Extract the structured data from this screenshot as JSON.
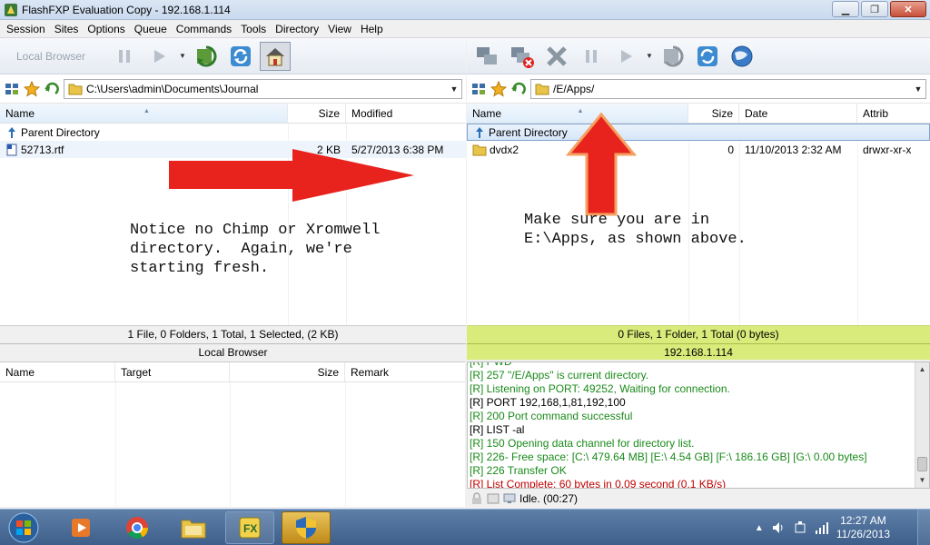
{
  "window": {
    "title": "FlashFXP Evaluation Copy - 192.168.1.114"
  },
  "menu": [
    "Session",
    "Sites",
    "Options",
    "Queue",
    "Commands",
    "Tools",
    "Directory",
    "View",
    "Help"
  ],
  "left_pane": {
    "toolbar_label": "Local Browser",
    "path": "C:\\Users\\admin\\Documents\\Journal",
    "columns": {
      "name": "Name",
      "size": "Size",
      "modified": "Modified"
    },
    "rows": [
      {
        "name": "Parent Directory",
        "size": "",
        "modified": ""
      },
      {
        "name": "52713.rtf",
        "size": "2 KB",
        "modified": "5/27/2013 6:38 PM"
      }
    ],
    "note": "Notice no Chimp or Xromwell\ndirectory.  Again, we're\nstarting fresh.",
    "status": "1 File, 0 Folders, 1 Total, 1 Selected, (2 KB)",
    "status_sub": "Local Browser"
  },
  "right_pane": {
    "path": "/E/Apps/",
    "columns": {
      "name": "Name",
      "size": "Size",
      "date": "Date",
      "attrib": "Attrib"
    },
    "rows": [
      {
        "name": "Parent Directory",
        "size": "",
        "date": "",
        "attrib": ""
      },
      {
        "name": "dvdx2",
        "size": "0",
        "date": "11/10/2013 2:32 AM",
        "attrib": "drwxr-xr-x"
      }
    ],
    "note": "Make sure you are in\nE:\\Apps, as shown above.",
    "status": "0 Files, 1 Folder, 1 Total (0 bytes)",
    "status_sub": "192.168.1.114"
  },
  "queue": {
    "columns": {
      "name": "Name",
      "target": "Target",
      "size": "Size",
      "remark": "Remark"
    }
  },
  "log": {
    "lines": [
      {
        "text": "[R] PWD",
        "color": "green"
      },
      {
        "text": "[R] 257 \"/E/Apps\" is current directory.",
        "color": "green"
      },
      {
        "text": "[R] Listening on PORT: 49252, Waiting for connection.",
        "color": "green"
      },
      {
        "text": "[R] PORT 192,168,1,81,192,100",
        "color": "black"
      },
      {
        "text": "[R] 200 Port command successful",
        "color": "green"
      },
      {
        "text": "[R] LIST -al",
        "color": "black"
      },
      {
        "text": "[R] 150 Opening data channel for directory list.",
        "color": "green"
      },
      {
        "text": "[R] 226- Free space: [C:\\ 479.64 MB] [E:\\ 4.54 GB] [F:\\ 186.16 GB] [G:\\ 0.00 bytes]",
        "color": "green"
      },
      {
        "text": "[R] 226 Transfer OK",
        "color": "green"
      },
      {
        "text": "[R] List Complete: 60 bytes in 0.09 second (0.1 KB/s)",
        "color": "red"
      }
    ],
    "status": "Idle. (00:27)"
  },
  "taskbar": {
    "time": "12:27 AM",
    "date": "11/26/2013"
  },
  "colors": {
    "status_green": "#d9eb7a",
    "arrow_red": "#e8231e",
    "log_green": "#1a8a1a",
    "log_red": "#c00000"
  }
}
